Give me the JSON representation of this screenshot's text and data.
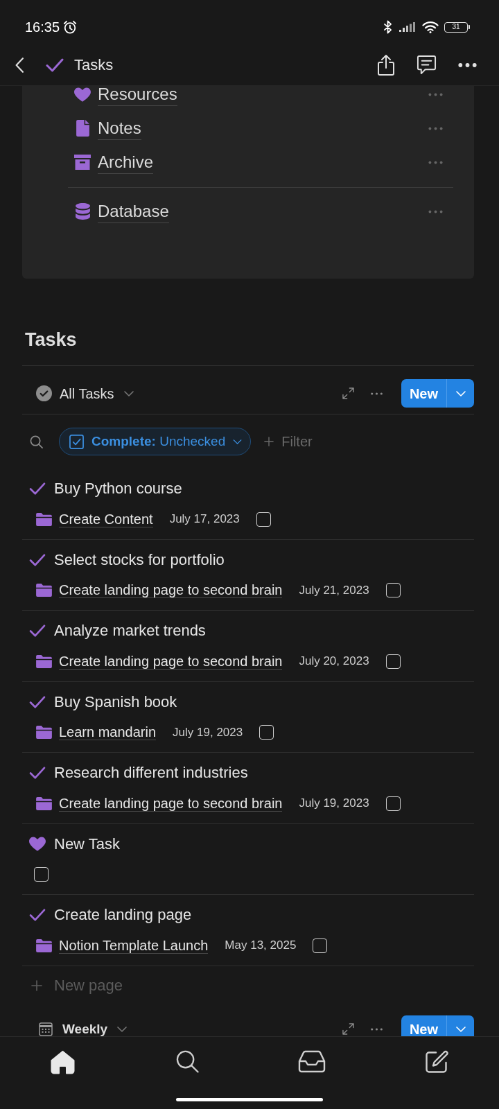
{
  "status_bar": {
    "time": "16:35",
    "battery": "31"
  },
  "header": {
    "title": "Tasks"
  },
  "linked_pages": {
    "groups": [
      {
        "pages": [
          {
            "title": "Resources",
            "kind": "heart"
          },
          {
            "title": "Notes",
            "kind": "page"
          },
          {
            "title": "Archive",
            "kind": "archive"
          }
        ]
      },
      {
        "pages": [
          {
            "title": "Database",
            "kind": "database"
          }
        ]
      }
    ]
  },
  "tasks_section": {
    "heading": "Tasks",
    "view": {
      "name": "All Tasks",
      "new_button": "New"
    },
    "filter": {
      "chip": "**Complete:** Unchecked",
      "add_filter": "Filter"
    },
    "tasks": [
      {
        "title": "Buy Python course",
        "kind": "check",
        "project": "Create Content",
        "date": "July 17, 2023",
        "checked": false
      },
      {
        "title": "Select stocks for portfolio",
        "kind": "check",
        "project": "Create landing page to second brain",
        "date": "July 21, 2023",
        "checked": false
      },
      {
        "title": "Analyze market trends",
        "kind": "check",
        "project": "Create landing page to second brain",
        "date": "July 20, 2023",
        "checked": false
      },
      {
        "title": "Buy Spanish book",
        "kind": "check",
        "project": "Learn mandarin",
        "date": "July 19, 2023",
        "checked": false
      },
      {
        "title": "Research different industries",
        "kind": "check",
        "project": "Create landing page to second brain",
        "date": "July 19, 2023",
        "checked": false
      },
      {
        "title": "New Task",
        "kind": "heart",
        "checked": false
      },
      {
        "title": "Create landing page",
        "kind": "check",
        "project": "Notion Template Launch",
        "date": "May 13, 2025",
        "checked": false
      }
    ],
    "new_page": "New page"
  },
  "next_view": {
    "name": "Weekly",
    "new_button": "New"
  },
  "bottom_nav": [
    {
      "kind": "home",
      "selected": true
    },
    {
      "kind": "search",
      "selected": false
    },
    {
      "kind": "inbox",
      "selected": false
    },
    {
      "kind": "compose",
      "selected": false
    }
  ]
}
